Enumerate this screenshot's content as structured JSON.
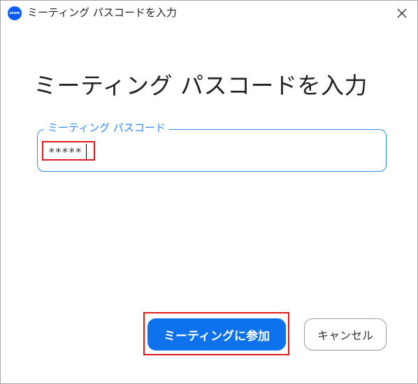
{
  "window": {
    "title": "ミーティング パスコードを入力",
    "app_logo_text": "zoom"
  },
  "dialog": {
    "heading": "ミーティング パスコードを入力",
    "passcode_field": {
      "label": "ミーティング パスコード",
      "value": "*****"
    },
    "join_label": "ミーティングに参加",
    "cancel_label": "キャンセル"
  },
  "colors": {
    "accent": "#2d8cff",
    "join_button": "#0e72ed",
    "highlight": "#e0191e"
  },
  "icons": {
    "close": "close-icon",
    "logo": "zoom-logo-icon"
  }
}
